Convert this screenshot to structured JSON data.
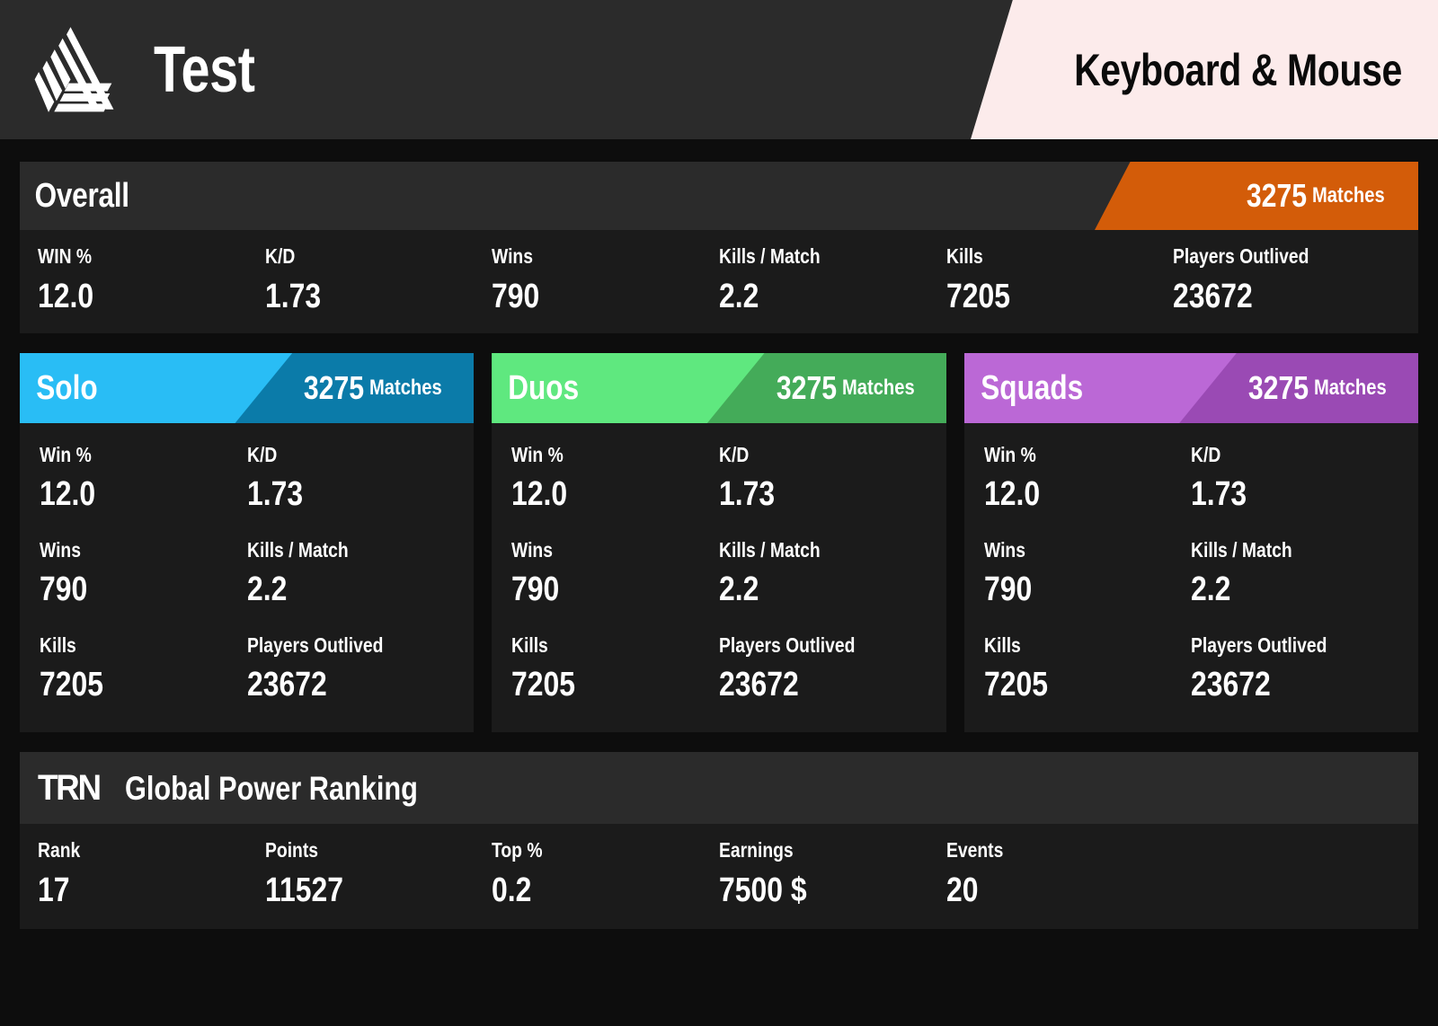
{
  "header": {
    "logo_icon": "fortnite-tracker-triangle-logo",
    "player_name": "Test",
    "platform": "Keyboard & Mouse"
  },
  "overall": {
    "title": "Overall",
    "matches_value": "3275",
    "matches_label": "Matches",
    "accent": "#d35c09",
    "stats": [
      {
        "label": "WIN %",
        "value": "12.0"
      },
      {
        "label": "K/D",
        "value": "1.73"
      },
      {
        "label": "Wins",
        "value": "790"
      },
      {
        "label": "Kills / Match",
        "value": "2.2"
      },
      {
        "label": "Kills",
        "value": "7205"
      },
      {
        "label": "Players Outlived",
        "value": "23672"
      }
    ]
  },
  "modes": [
    {
      "title": "Solo",
      "matches_value": "3275",
      "matches_label": "Matches",
      "accent_light": "#29bdf5",
      "accent_dark": "#0b7ba9",
      "stats": [
        {
          "label": "Win %",
          "value": "12.0"
        },
        {
          "label": "K/D",
          "value": "1.73"
        },
        {
          "label": "Wins",
          "value": "790"
        },
        {
          "label": "Kills / Match",
          "value": "2.2"
        },
        {
          "label": "Kills",
          "value": "7205"
        },
        {
          "label": "Players Outlived",
          "value": "23672"
        }
      ]
    },
    {
      "title": "Duos",
      "matches_value": "3275",
      "matches_label": "Matches",
      "accent_light": "#5fe87f",
      "accent_dark": "#44ab59",
      "stats": [
        {
          "label": "Win %",
          "value": "12.0"
        },
        {
          "label": "K/D",
          "value": "1.73"
        },
        {
          "label": "Wins",
          "value": "790"
        },
        {
          "label": "Kills / Match",
          "value": "2.2"
        },
        {
          "label": "Kills",
          "value": "7205"
        },
        {
          "label": "Players Outlived",
          "value": "23672"
        }
      ]
    },
    {
      "title": "Squads",
      "matches_value": "3275",
      "matches_label": "Matches",
      "accent_light": "#bb68d6",
      "accent_dark": "#9a4ab4",
      "stats": [
        {
          "label": "Win %",
          "value": "12.0"
        },
        {
          "label": "K/D",
          "value": "1.73"
        },
        {
          "label": "Wins",
          "value": "790"
        },
        {
          "label": "Kills / Match",
          "value": "2.2"
        },
        {
          "label": "Kills",
          "value": "7205"
        },
        {
          "label": "Players Outlived",
          "value": "23672"
        }
      ]
    }
  ],
  "global_power_ranking": {
    "brand": "TRN",
    "title": "Global Power Ranking",
    "stats": [
      {
        "label": "Rank",
        "value": "17"
      },
      {
        "label": "Points",
        "value": "11527"
      },
      {
        "label": "Top %",
        "value": "0.2"
      },
      {
        "label": "Earnings",
        "value": "7500 $"
      },
      {
        "label": "Events",
        "value": "20"
      }
    ]
  }
}
